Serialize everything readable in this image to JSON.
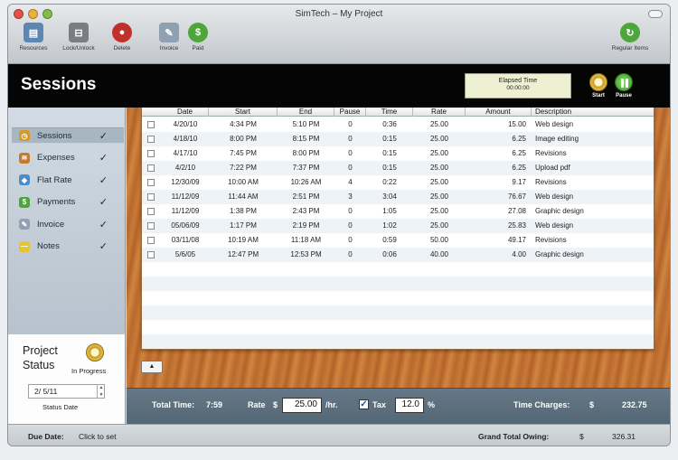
{
  "window": {
    "title": "SimTech – My Project"
  },
  "toolbar": [
    {
      "label": "Resources",
      "icon": "resources-icon",
      "color": "#5f86b2"
    },
    {
      "label": "Lock/Unlock",
      "icon": "lock-icon",
      "color": "#7a7d82"
    },
    {
      "label": "Delete",
      "icon": "delete-icon",
      "color": "#c0312b"
    },
    {
      "label": "Invoice",
      "icon": "invoice-icon",
      "color": "#8fa0b3"
    },
    {
      "label": "Paid",
      "icon": "paid-icon",
      "color": "#4da63a"
    },
    {
      "label": "Regular Items",
      "icon": "regular-items-icon",
      "color": "#4da63a"
    }
  ],
  "header": {
    "title": "Sessions",
    "elapsed_label": "Elapsed Time",
    "elapsed_value": "00:00:00",
    "start_label": "Start",
    "pause_label": "Pause"
  },
  "sidebar": {
    "items": [
      {
        "label": "Sessions",
        "check": "✓",
        "icon": "clock-icon",
        "color": "#d39a2a"
      },
      {
        "label": "Expenses",
        "check": "✓",
        "icon": "expenses-icon",
        "color": "#c7792e"
      },
      {
        "label": "Flat Rate",
        "check": "✓",
        "icon": "flat-rate-icon",
        "color": "#4b8bc9"
      },
      {
        "label": "Payments",
        "check": "✓",
        "icon": "payments-icon",
        "color": "#4da63a"
      },
      {
        "label": "Invoice",
        "check": "✓",
        "icon": "invoice-icon",
        "color": "#8fa0b3"
      },
      {
        "label": "Notes",
        "check": "✓",
        "icon": "notes-icon",
        "color": "#e6c430"
      }
    ]
  },
  "status": {
    "title_line1": "Project",
    "title_line2": "Status",
    "state": "In Progress",
    "date_value": "2/ 5/11",
    "date_label": "Status Date"
  },
  "table": {
    "columns": [
      "Date",
      "Start",
      "End",
      "Pause",
      "Time",
      "Rate",
      "Amount",
      "Description"
    ],
    "rows": [
      [
        "4/20/10",
        "4:34 PM",
        "5:10 PM",
        "0",
        "0:36",
        "25.00",
        "15.00",
        "Web design"
      ],
      [
        "4/18/10",
        "8:00 PM",
        "8:15 PM",
        "0",
        "0:15",
        "25.00",
        "6.25",
        "Image editing"
      ],
      [
        "4/17/10",
        "7:45 PM",
        "8:00 PM",
        "0",
        "0:15",
        "25.00",
        "6.25",
        "Revisions"
      ],
      [
        "4/2/10",
        "7:22 PM",
        "7:37 PM",
        "0",
        "0:15",
        "25.00",
        "6.25",
        "Upload pdf"
      ],
      [
        "12/30/09",
        "10:00 AM",
        "10:26 AM",
        "4",
        "0:22",
        "25.00",
        "9.17",
        "Revisions"
      ],
      [
        "11/12/09",
        "11:44 AM",
        "2:51 PM",
        "3",
        "3:04",
        "25.00",
        "76.67",
        "Web design"
      ],
      [
        "11/12/09",
        "1:38 PM",
        "2:43 PM",
        "0",
        "1:05",
        "25.00",
        "27.08",
        "Graphic design"
      ],
      [
        "05/06/09",
        "1:17 PM",
        "2:19 PM",
        "0",
        "1:02",
        "25.00",
        "25.83",
        "Web design"
      ],
      [
        "03/11/08",
        "10:19 AM",
        "11:18 AM",
        "0",
        "0:59",
        "50.00",
        "49.17",
        "Revisions"
      ],
      [
        "5/6/05",
        "12:47 PM",
        "12:53 PM",
        "0",
        "0:06",
        "40.00",
        "4.00",
        "Graphic design"
      ]
    ]
  },
  "summary": {
    "total_time_label": "Total Time:",
    "total_time_value": "7:59",
    "rate_label": "Rate",
    "currency": "$",
    "rate_value": "25.00",
    "rate_unit": "/hr.",
    "tax_label": "Tax",
    "tax_value": "12.0",
    "tax_unit": "%",
    "tax_checked": "✓",
    "time_charges_label": "Time Charges:",
    "time_charges_value": "232.75"
  },
  "footer": {
    "due_date_label": "Due Date:",
    "due_date_value": "Click to set",
    "grand_total_label": "Grand Total Owing:",
    "grand_total_value": "326.31"
  },
  "colors": {
    "accent_green": "#4da63a",
    "header_bg": "#050505",
    "summary_bg": "#5d6f7e"
  }
}
